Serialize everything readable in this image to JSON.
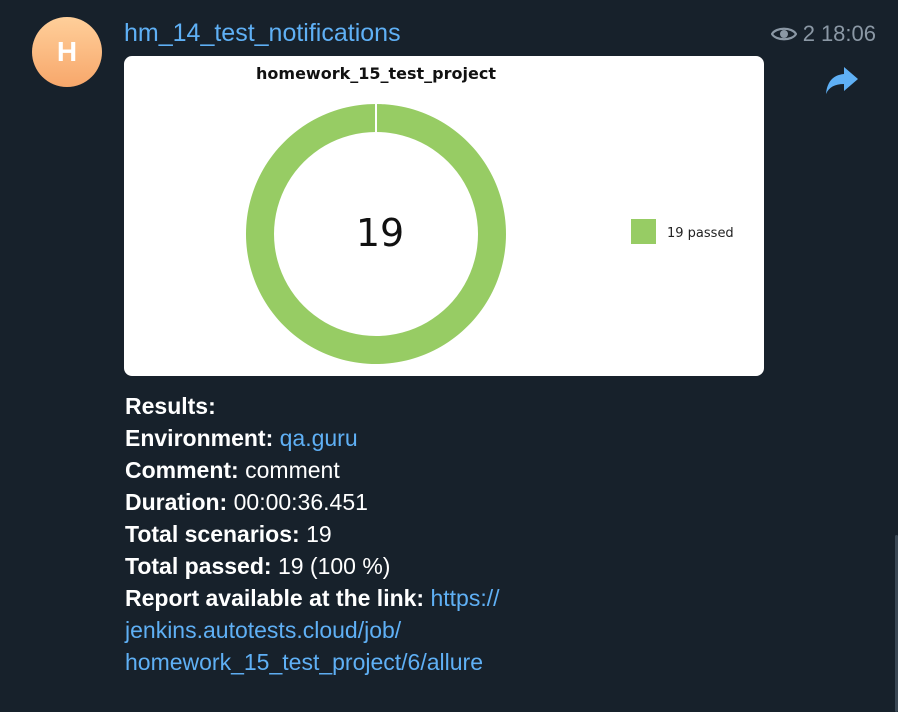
{
  "avatar": {
    "initial": "H",
    "color": "#f7a76b"
  },
  "channel": {
    "name": "hm_14_test_notifications"
  },
  "meta": {
    "views": "2",
    "time": "18:06",
    "icon": "eye-icon"
  },
  "forward": {
    "icon": "forward-icon",
    "color": "#5fb0f5"
  },
  "chart_data": {
    "type": "pie",
    "title": "homework_15_test_project",
    "center_label": "19",
    "series": [
      {
        "name": "19 passed",
        "value": 19,
        "color": "#97cc64"
      }
    ],
    "legend_position": "right"
  },
  "message": {
    "results_label": "Results:",
    "environment_label": "Environment:",
    "environment_value": "qa.guru",
    "comment_label": "Comment:",
    "comment_value": "comment",
    "duration_label": "Duration:",
    "duration_value": "00:00:36.451",
    "total_scenarios_label": "Total scenarios:",
    "total_scenarios_value": "19",
    "total_passed_label": "Total passed:",
    "total_passed_value": "19 (100 %)",
    "report_label": "Report available at the link:",
    "report_link_line1": "https://",
    "report_link_line2": "jenkins.autotests.cloud/job/",
    "report_link_line3": "homework_15_test_project/6/allure"
  }
}
